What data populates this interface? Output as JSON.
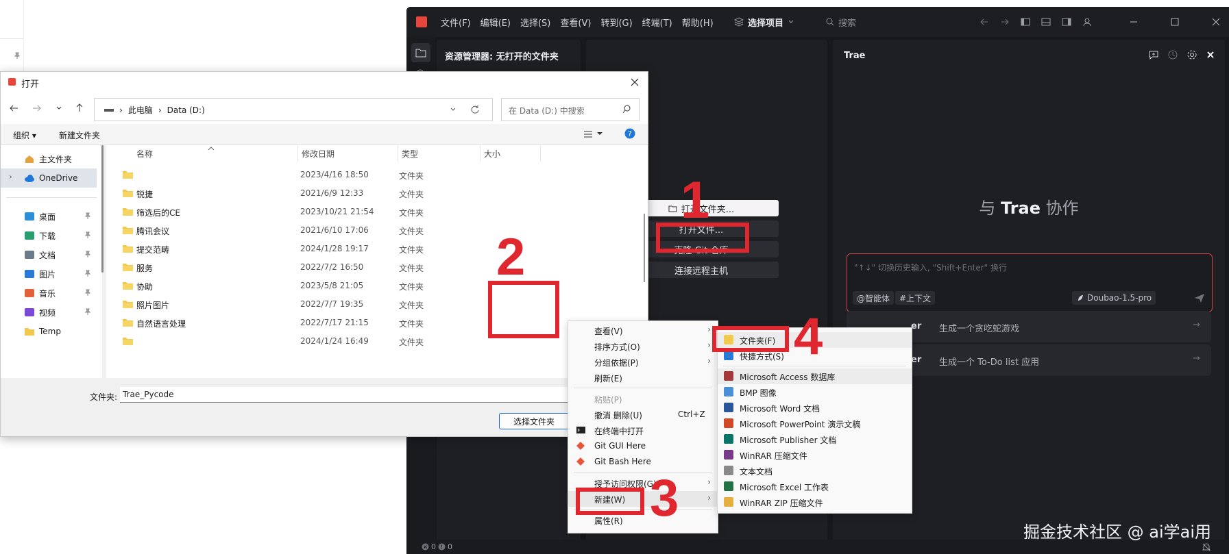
{
  "trae": {
    "menu": [
      "文件(F)",
      "编辑(E)",
      "选择(S)",
      "查看(V)",
      "转到(G)",
      "终端(T)",
      "帮助(H)"
    ],
    "project_selector": "选择项目",
    "search_placeholder": "搜索",
    "explorer_title": "资源管理器: 无打开的文件夹",
    "welcome_buttons": [
      "打开文件夹...",
      "打开文件...",
      "克隆 Git 仓库",
      "连接远程主机"
    ],
    "chat": {
      "title": "Trae",
      "collab_prefix": "与",
      "collab_brand": "Trae",
      "collab_suffix": "协作",
      "input_placeholder": "\"↑↓\" 切换历史输入, \"Shift+Enter\" 换行",
      "chip_agent": "@智能体",
      "chip_context": "#上下文",
      "model": "Doubao-1.5-pro",
      "suggestions": [
        {
          "bold": "er",
          "text": "生成一个贪吃蛇游戏"
        },
        {
          "bold": "er",
          "text": "生成一个 To-Do list 应用"
        }
      ]
    },
    "status": {
      "errors": "0",
      "warnings": "0"
    },
    "watermark": "掘金技术社区 @ ai学ai用"
  },
  "dialog": {
    "title": "打开",
    "breadcrumb": [
      "此电脑",
      "Data (D:)"
    ],
    "search_placeholder": "在 Data (D:) 中搜索",
    "organize": "组织 ▾",
    "new_folder": "新建文件夹",
    "nav": [
      {
        "label": "主文件夹",
        "icon": "home-icon",
        "pin": false,
        "sel": false
      },
      {
        "label": "OneDrive",
        "icon": "cloud-icon",
        "pin": false,
        "sel": true
      },
      {
        "label": "桌面",
        "icon": "desktop-icon",
        "pin": true,
        "sel": false
      },
      {
        "label": "下载",
        "icon": "download-icon",
        "pin": true,
        "sel": false
      },
      {
        "label": "文档",
        "icon": "document-icon",
        "pin": true,
        "sel": false
      },
      {
        "label": "图片",
        "icon": "picture-icon",
        "pin": true,
        "sel": false
      },
      {
        "label": "音乐",
        "icon": "music-icon",
        "pin": true,
        "sel": false
      },
      {
        "label": "视频",
        "icon": "video-icon",
        "pin": true,
        "sel": false
      },
      {
        "label": "Temp",
        "icon": "folder-icon",
        "pin": false,
        "sel": false
      }
    ],
    "columns": [
      "名称",
      "修改日期",
      "类型",
      "大小"
    ],
    "files": [
      {
        "name": "",
        "date": "2023/4/16 18:50",
        "type": "文件夹"
      },
      {
        "name": "锐捷",
        "date": "2021/6/9 12:33",
        "type": "文件夹"
      },
      {
        "name": "筛选后的CE",
        "date": "2023/10/21 21:54",
        "type": "文件夹"
      },
      {
        "name": "腾讯会议",
        "date": "2021/6/10 17:06",
        "type": "文件夹"
      },
      {
        "name": "提交范畴",
        "date": "2024/1/28 19:17",
        "type": "文件夹"
      },
      {
        "name": "服务",
        "date": "2022/7/2 16:50",
        "type": "文件夹"
      },
      {
        "name": "协助",
        "date": "2023/5/8 21:05",
        "type": "文件夹"
      },
      {
        "name": "照片图片",
        "date": "2022/7/7 19:35",
        "type": "文件夹"
      },
      {
        "name": "自然语言处理",
        "date": "2022/7/17 21:15",
        "type": "文件夹"
      },
      {
        "name": "",
        "date": "2024/1/24 16:49",
        "type": "文件夹"
      }
    ],
    "folder_label": "文件夹:",
    "folder_value": "Trae_Pycode",
    "select_button": "选择文件夹"
  },
  "context_menu": [
    {
      "label": "查看(V)",
      "arrow": true
    },
    {
      "label": "排序方式(O)",
      "arrow": true
    },
    {
      "label": "分组依据(P)",
      "arrow": true
    },
    {
      "label": "刷新(E)"
    },
    {
      "sep": true
    },
    {
      "label": "粘贴(P)",
      "disabled": true
    },
    {
      "label": "撤消 删除(U)",
      "shortcut": "Ctrl+Z"
    },
    {
      "label": "在终端中打开",
      "icon": "terminal-icon"
    },
    {
      "label": "Git GUI Here",
      "icon": "git-icon"
    },
    {
      "label": "Git Bash Here",
      "icon": "git-icon"
    },
    {
      "sep": true
    },
    {
      "label": "授予访问权限(G)",
      "arrow": true
    },
    {
      "label": "新建(W)",
      "arrow": true,
      "hi": true
    },
    {
      "sep": true
    },
    {
      "label": "属性(R)"
    }
  ],
  "new_submenu": [
    {
      "label": "文件夹(F)",
      "icon": "folder-icon",
      "hi": true
    },
    {
      "label": "快捷方式(S)",
      "icon": "shortcut-icon"
    },
    {
      "sep": true
    },
    {
      "label": "Microsoft Access 数据库",
      "icon": "access-icon",
      "hi": true
    },
    {
      "label": "BMP 图像",
      "icon": "bmp-icon"
    },
    {
      "label": "Microsoft Word 文档",
      "icon": "word-icon"
    },
    {
      "label": "Microsoft PowerPoint 演示文稿",
      "icon": "powerpoint-icon"
    },
    {
      "label": "Microsoft Publisher 文档",
      "icon": "publisher-icon"
    },
    {
      "label": "WinRAR 压缩文件",
      "icon": "winrar-icon"
    },
    {
      "label": "文本文档",
      "icon": "text-icon"
    },
    {
      "label": "Microsoft Excel 工作表",
      "icon": "excel-icon"
    },
    {
      "label": "WinRAR ZIP 压缩文件",
      "icon": "zip-icon"
    }
  ],
  "annotations": [
    "1",
    "2",
    "3",
    "4"
  ],
  "colors": {
    "annotation": "#e0262e",
    "ide_bg": "#17181b",
    "panel_bg": "#1e1f23",
    "accent_red": "#e8463a",
    "dialog_bg": "#f0f0f0"
  }
}
